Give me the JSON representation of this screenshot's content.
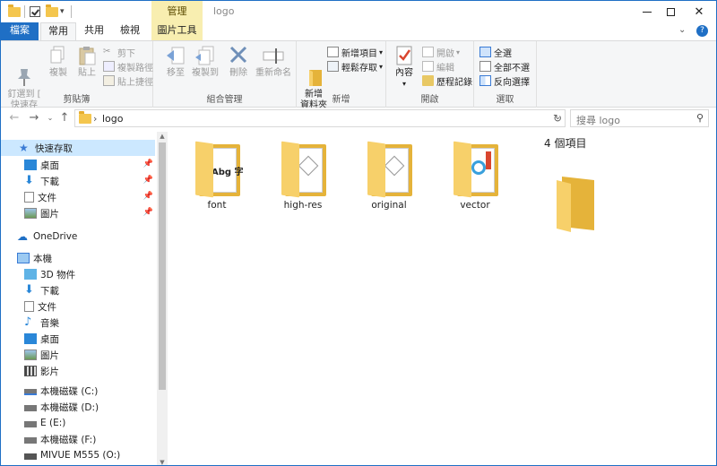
{
  "window": {
    "title": "logo",
    "context_tab": "管理",
    "controls": {
      "minimize": "—",
      "maximize": "□",
      "close": "✕"
    }
  },
  "ribbon_tabs": {
    "file": "檔案",
    "home": "常用",
    "share": "共用",
    "view": "檢視",
    "picture_tools": "圖片工具"
  },
  "ribbon": {
    "clipboard": {
      "label": "剪貼簿",
      "pin_quick_access": "釘選到 [\n快速存取]",
      "copy": "複製",
      "paste": "貼上",
      "cut": "剪下",
      "copy_path": "複製路徑",
      "paste_shortcut": "貼上捷徑"
    },
    "organize": {
      "label": "組合管理",
      "move_to": "移至",
      "copy_to": "複製到",
      "delete": "刪除",
      "rename": "重新命名"
    },
    "new": {
      "label": "新增",
      "new_folder": "新增\n資料夾",
      "new_item": "新增項目",
      "easy_access": "輕鬆存取"
    },
    "open": {
      "label": "開啟",
      "properties": "內容",
      "open": "開啟",
      "edit": "編輯",
      "history": "歷程記錄"
    },
    "select": {
      "label": "選取",
      "select_all": "全選",
      "select_none": "全部不選",
      "invert": "反向選擇"
    }
  },
  "address": {
    "path": "logo",
    "search_placeholder": "搜尋 logo"
  },
  "nav": {
    "quick_access": "快速存取",
    "quick_items": [
      "桌面",
      "下載",
      "文件",
      "圖片"
    ],
    "onedrive": "OneDrive",
    "this_pc": "本機",
    "pc_items": [
      "3D 物件",
      "下載",
      "文件",
      "音樂",
      "桌面",
      "圖片",
      "影片"
    ],
    "drives": [
      "本機磁碟 (C:)",
      "本機磁碟 (D:)",
      "E (E:)",
      "本機磁碟 (F:)",
      "MIVUE M555 (O:)"
    ]
  },
  "content": {
    "folders": [
      {
        "name": "font",
        "preview_text": "Abg 字"
      },
      {
        "name": "high-res",
        "preview_text": ""
      },
      {
        "name": "original",
        "preview_text": ""
      },
      {
        "name": "vector",
        "preview_text": ""
      }
    ]
  },
  "details": {
    "item_count": "4 個項目"
  },
  "colors": {
    "accent": "#1f6fc5",
    "context_tab": "#f8eeb0",
    "selection": "#cce8ff",
    "folder": "#f4c64e"
  }
}
